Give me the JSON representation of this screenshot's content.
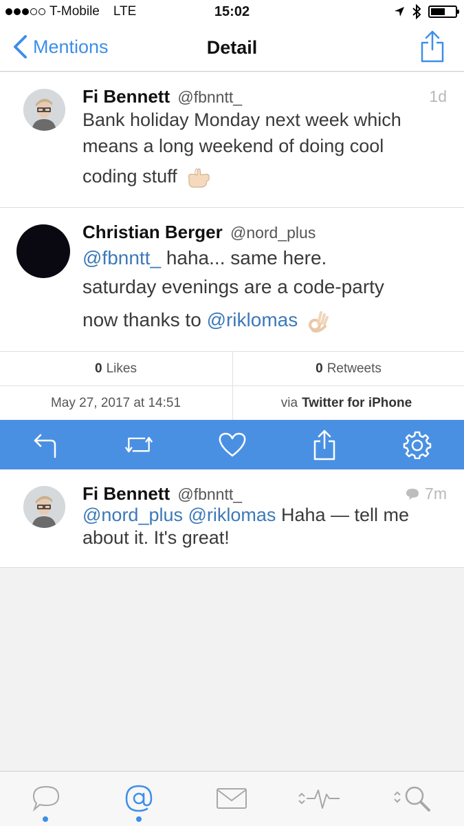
{
  "status_bar": {
    "carrier": "T-Mobile",
    "network": "LTE",
    "time": "15:02"
  },
  "nav": {
    "back_label": "Mentions",
    "title": "Detail"
  },
  "tweets": [
    {
      "name": "Fi Bennett",
      "handle": "@fbnntt_",
      "time": "1d",
      "lines": [
        "Bank holiday Monday next week which",
        "means a long weekend of doing cool",
        "coding stuff"
      ]
    },
    {
      "name": "Christian Berger",
      "handle": "@nord_plus",
      "mention1": "@fbnntt_",
      "line1_rest": " haha... same here.",
      "line2": "saturday evenings are a code-party",
      "line3_pre": "now thanks to ",
      "mention2": "@riklomas"
    }
  ],
  "stats": {
    "likes_count": "0",
    "likes_label": "Likes",
    "retweets_count": "0",
    "retweets_label": "Retweets",
    "date": "May 27, 2017 at 14:51",
    "via_prefix": "via",
    "via_client": "Twitter for iPhone"
  },
  "reply": {
    "name": "Fi Bennett",
    "handle": "@fbnntt_",
    "time": "7m",
    "mention1": "@nord_plus",
    "mention2": "@riklomas",
    "line1_rest": " Haha — tell me",
    "line2": "about it. It's great!"
  },
  "actions": [
    "reply-icon",
    "retweet-icon",
    "like-heart-icon",
    "share-icon",
    "settings-gear-icon"
  ],
  "tabs": [
    "timeline-bubble-icon",
    "mentions-at-icon",
    "messages-envelope-icon",
    "activity-pulse-icon",
    "search-magnifier-icon"
  ],
  "colors": {
    "accent": "#3d8eea",
    "action_bar": "#4a90e2",
    "mention": "#3d79b8"
  }
}
